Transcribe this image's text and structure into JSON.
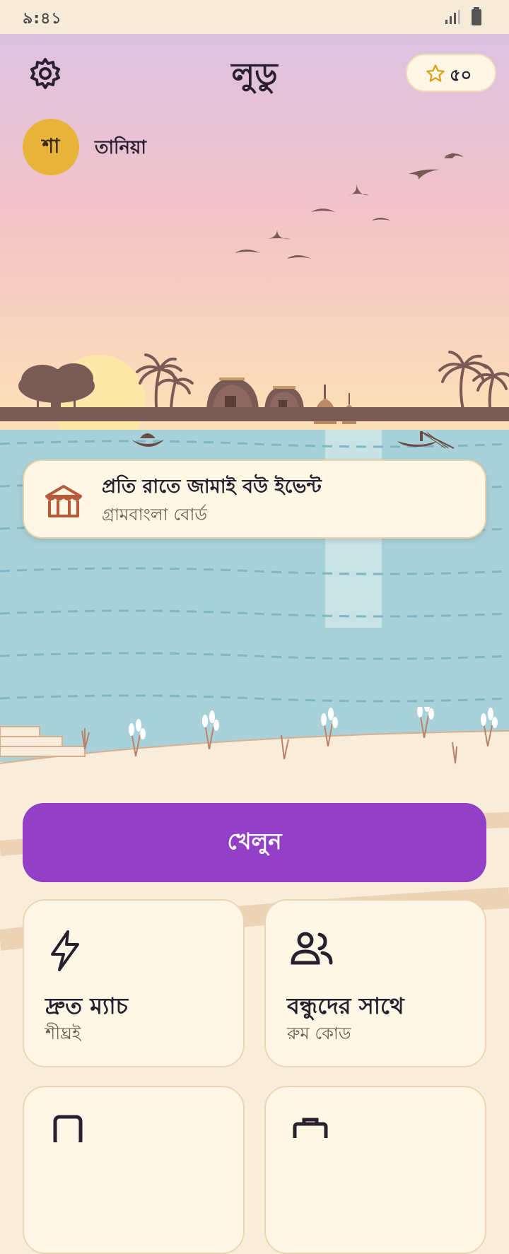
{
  "status_bar": {
    "time": "৯:৪১"
  },
  "header": {
    "title": "লুডু",
    "coins": "৫০"
  },
  "player": {
    "initials": "শা",
    "name": "তানিয়া"
  },
  "event": {
    "title": "প্রতি রাতে জামাই বউ ইভেন্ট",
    "subtitle": "গ্রামবাংলা বোর্ড"
  },
  "play_button": {
    "label": "খেলুন"
  },
  "modes": [
    {
      "title": "দ্রুত ম্যাচ",
      "subtitle": "শীঘ্রই",
      "icon": "lightning-icon"
    },
    {
      "title": "বন্ধুদের সাথে",
      "subtitle": "রুম কোড",
      "icon": "users-icon"
    },
    {
      "title": "",
      "subtitle": "",
      "icon": "phone-icon"
    },
    {
      "title": "",
      "subtitle": "",
      "icon": "briefcase-icon"
    }
  ],
  "colors": {
    "accent": "#9340c6",
    "coin": "#e8b43a",
    "river": "#a9d1da",
    "earth": "#6b4a44"
  }
}
